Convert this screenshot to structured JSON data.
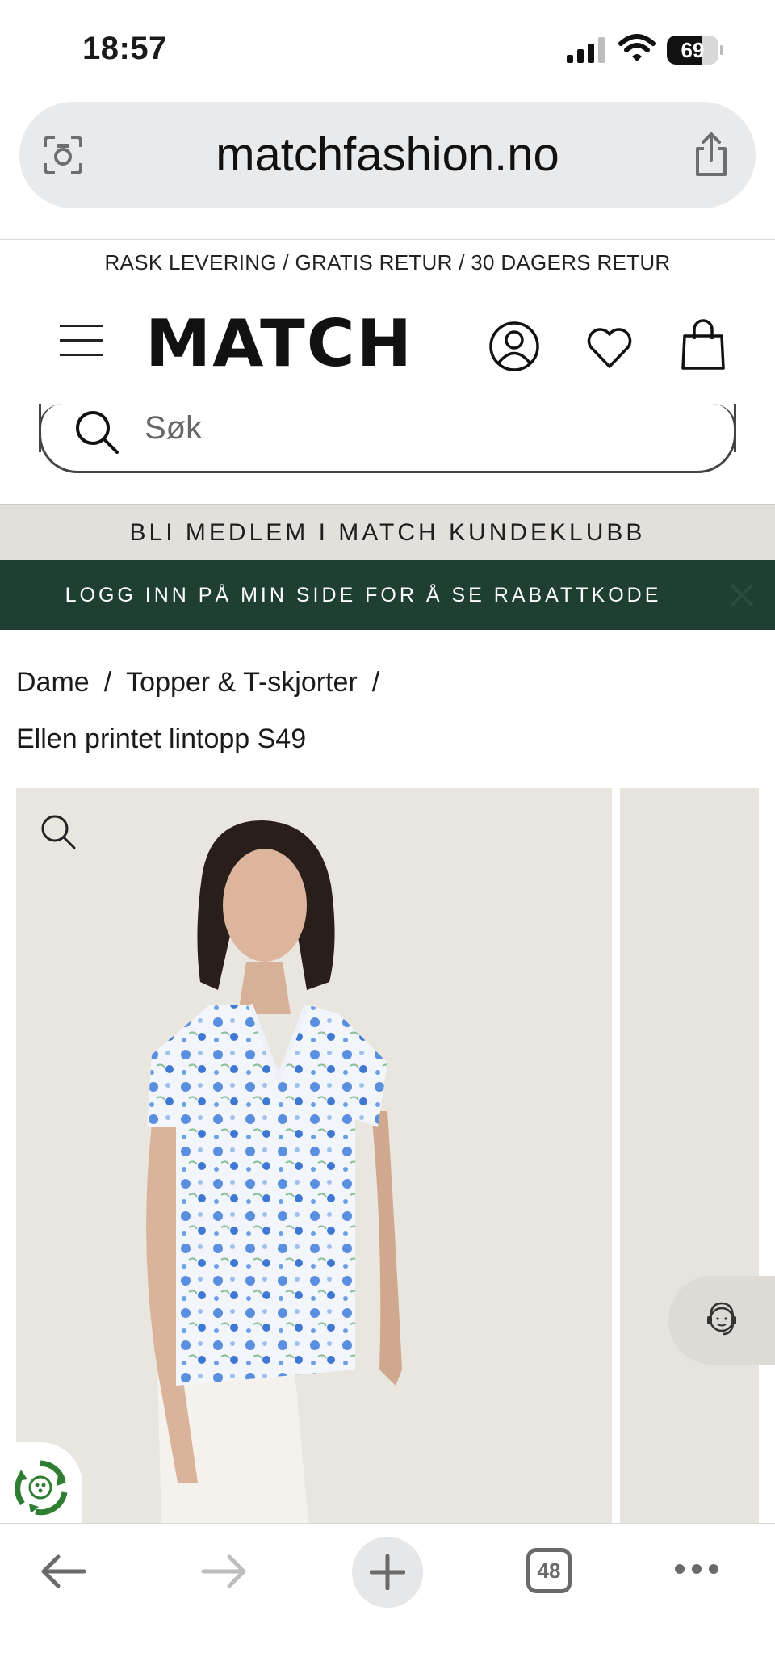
{
  "status_bar": {
    "time": "18:57",
    "battery_level": "69"
  },
  "browser": {
    "url": "matchfashion.no",
    "tab_count": "48"
  },
  "promo": {
    "text": "RASK LEVERING / GRATIS RETUR / 30 DAGERS RETUR"
  },
  "header": {
    "logo": "MATCH",
    "icons": [
      "menu-icon",
      "account-icon",
      "heart-icon",
      "bag-icon"
    ]
  },
  "search": {
    "placeholder": "Søk"
  },
  "banners": {
    "club": "BLI MEDLEM I MATCH KUNDEKLUBB",
    "login": "LOGG INN PÅ MIN SIDE FOR Å SE RABATTKODE"
  },
  "breadcrumb": {
    "items": [
      "Dame",
      "Topper & T-skjorter"
    ],
    "separator": "/",
    "current": "Ellen printet lintopp S49"
  },
  "colors": {
    "login_banner_bg": "#1f3f33",
    "club_banner_bg": "#e3dfdb",
    "url_bar_bg": "#e8eaec",
    "eco_green": "#2e7d32"
  }
}
